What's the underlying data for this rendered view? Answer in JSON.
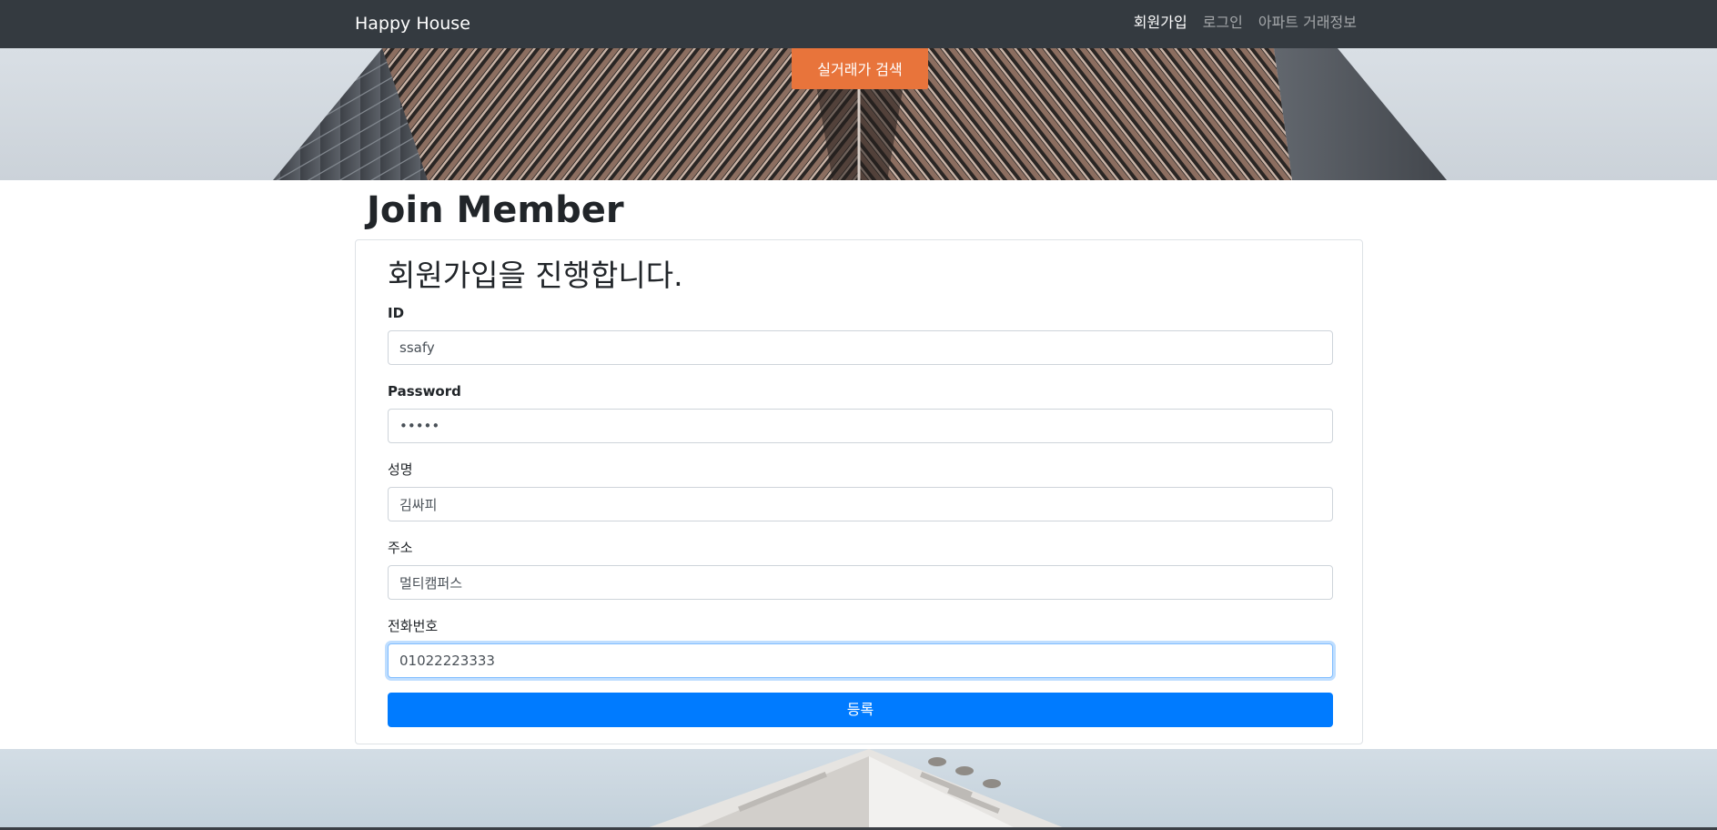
{
  "navbar": {
    "brand": "Happy House",
    "links": [
      {
        "label": "회원가입",
        "active": true
      },
      {
        "label": "로그인",
        "active": false
      },
      {
        "label": "아파트 거래정보",
        "active": false
      }
    ]
  },
  "hero": {
    "search_button": "실거래가 검색"
  },
  "page": {
    "title": "Join Member"
  },
  "form": {
    "heading": "회원가입을 진행합니다.",
    "fields": [
      {
        "label": "ID",
        "value": "ssafy",
        "type": "text"
      },
      {
        "label": "Password",
        "value": "ssafy",
        "type": "password"
      },
      {
        "label": "성명",
        "value": "김싸피",
        "type": "text"
      },
      {
        "label": "주소",
        "value": "멀티캠퍼스",
        "type": "text"
      },
      {
        "label": "전화번호",
        "value": "01022223333",
        "type": "text",
        "focused": true
      }
    ],
    "submit": "등록"
  },
  "colors": {
    "navbar_bg": "#343a40",
    "accent_orange": "#e8743b",
    "primary_blue": "#007bff"
  }
}
